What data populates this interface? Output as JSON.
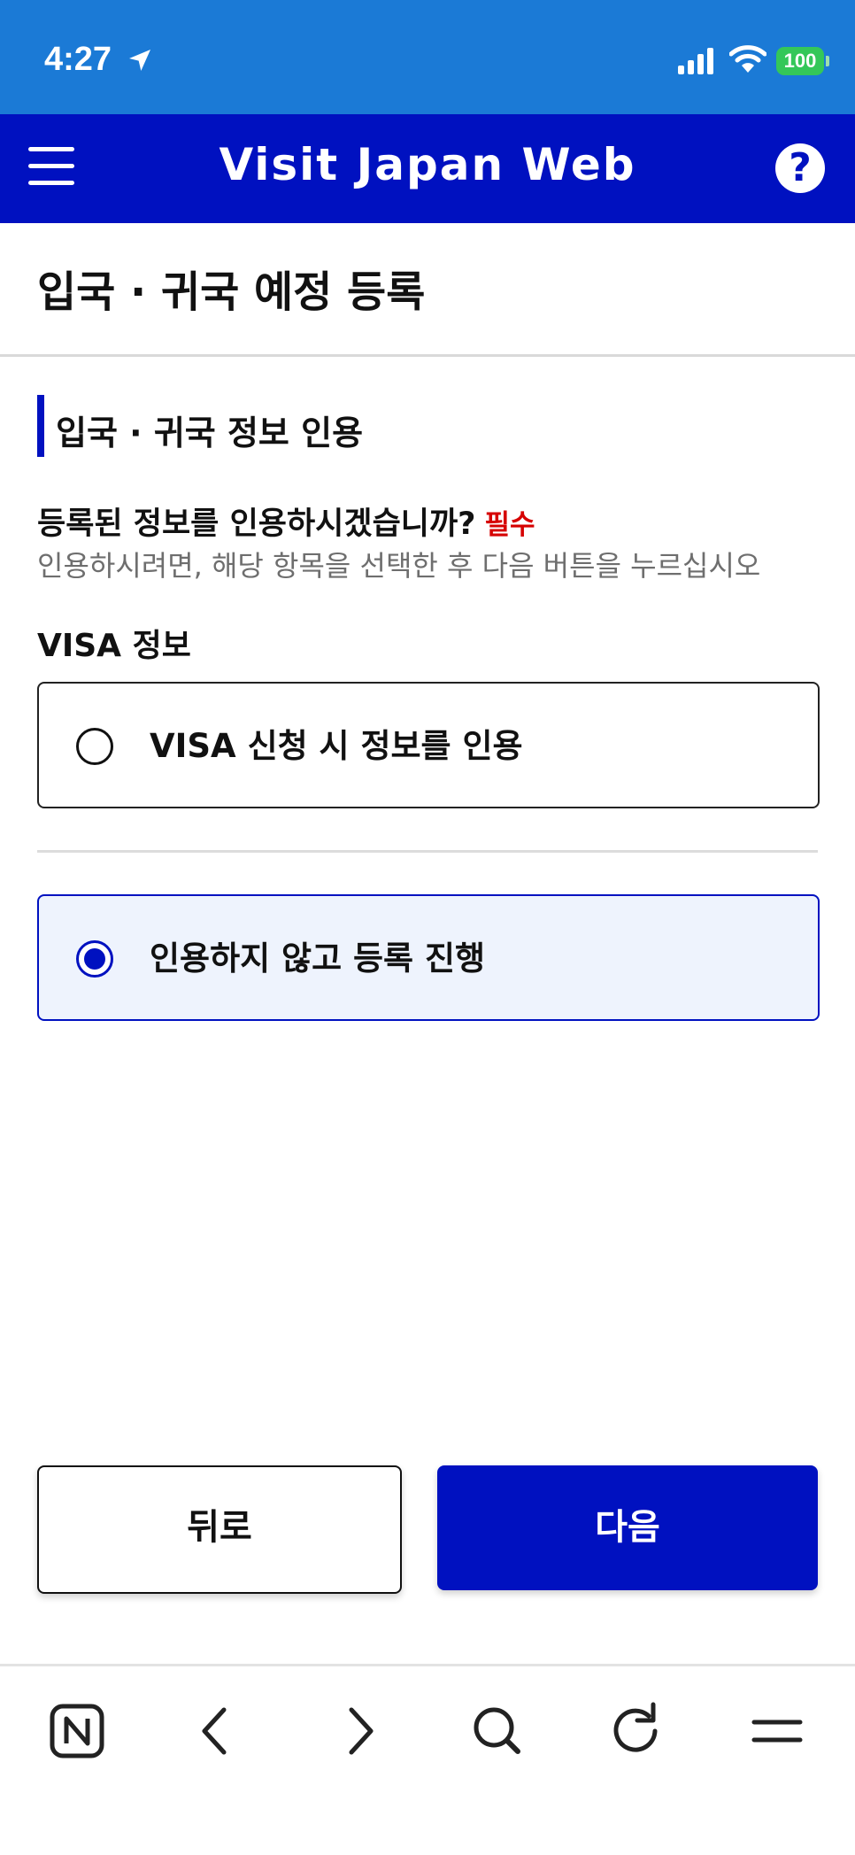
{
  "status_bar": {
    "time": "4:27",
    "battery": "100",
    "icons": [
      "location-arrow-icon",
      "cellular-signal-icon",
      "wifi-icon",
      "battery-icon"
    ]
  },
  "header": {
    "title": "Visit Japan Web",
    "menu_icon": "hamburger-menu-icon",
    "help_icon": "question-mark-icon",
    "help_symbol": "?"
  },
  "page": {
    "title": "입국 · 귀국 예정 등록"
  },
  "section": {
    "heading": "입국 · 귀국 정보 인용",
    "question": "등록된 정보를 인용하시겠습니까?",
    "required": "필수",
    "hint": "인용하시려면, 해당 항목을 선택한 후 다음 버튼을 누르십시오",
    "group_label": "VISA 정보",
    "options": [
      {
        "label": "VISA 신청 시 정보를 인용",
        "selected": false
      },
      {
        "label": "인용하지 않고 등록 진행",
        "selected": true
      }
    ]
  },
  "buttons": {
    "back": "뒤로",
    "next": "다음"
  },
  "browser_toolbar": {
    "icons": [
      "naver-n-icon",
      "back-arrow-icon",
      "forward-arrow-icon",
      "search-icon",
      "reload-icon",
      "menu-icon"
    ]
  },
  "colors": {
    "status_bar": "#1b7ad6",
    "brand_blue": "#0011c0",
    "required_red": "#d60000",
    "selected_bg": "#eef3fd",
    "battery_green": "#34c759"
  }
}
